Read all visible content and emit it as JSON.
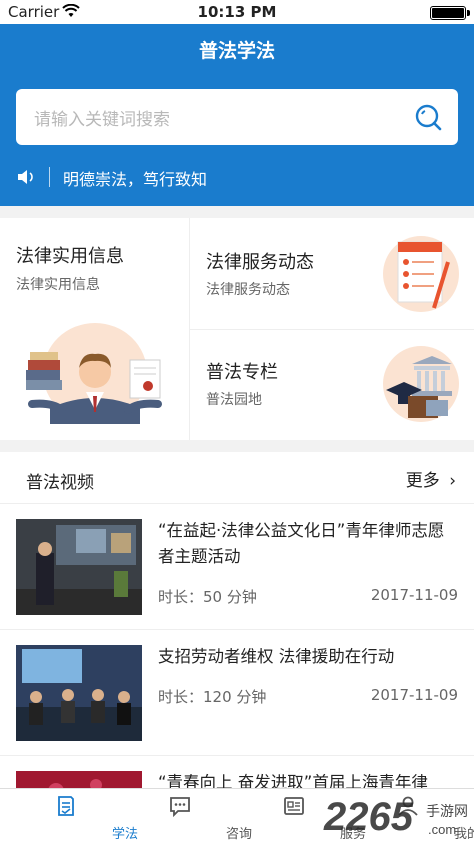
{
  "status_bar": {
    "carrier": "Carrier",
    "time": "10:13 PM"
  },
  "header": {
    "title": "普法学法",
    "search_placeholder": "请输入关键词搜索",
    "notice": "明德崇法，笃行致知"
  },
  "colors": {
    "primary": "#1a7ccd",
    "accent_orange": "#f08a24"
  },
  "grid": {
    "legal_info": {
      "title": "法律实用信息",
      "subtitle": "法律实用信息"
    },
    "legal_services": {
      "title": "法律服务动态",
      "subtitle": "法律服务动态"
    },
    "column": {
      "title": "普法专栏",
      "subtitle": "普法园地"
    }
  },
  "videos": {
    "section_title": "普法视频",
    "more_label": "更多",
    "items": [
      {
        "title": "“在益起·法律公益文化日”青年律师志愿者主题活动",
        "duration": "时长：50 分钟",
        "date": "2017-11-09"
      },
      {
        "title": "支招劳动者维权 法律援助在行动",
        "duration": "时长：120 分钟",
        "date": "2017-11-09"
      },
      {
        "title": "“青春向上 奋发进取”首届上海青年律"
      }
    ]
  },
  "tabbar": {
    "tabs": [
      {
        "label": "学法",
        "icon": "book-icon",
        "active": true
      },
      {
        "label": "咨询",
        "icon": "chat-icon",
        "active": false
      },
      {
        "label": "服务",
        "icon": "service-icon",
        "active": false
      },
      {
        "label": "我的",
        "icon": "user-icon",
        "active": false
      }
    ]
  },
  "watermark": {
    "text": "2265",
    "sub": "手游网",
    "url": ".com"
  }
}
